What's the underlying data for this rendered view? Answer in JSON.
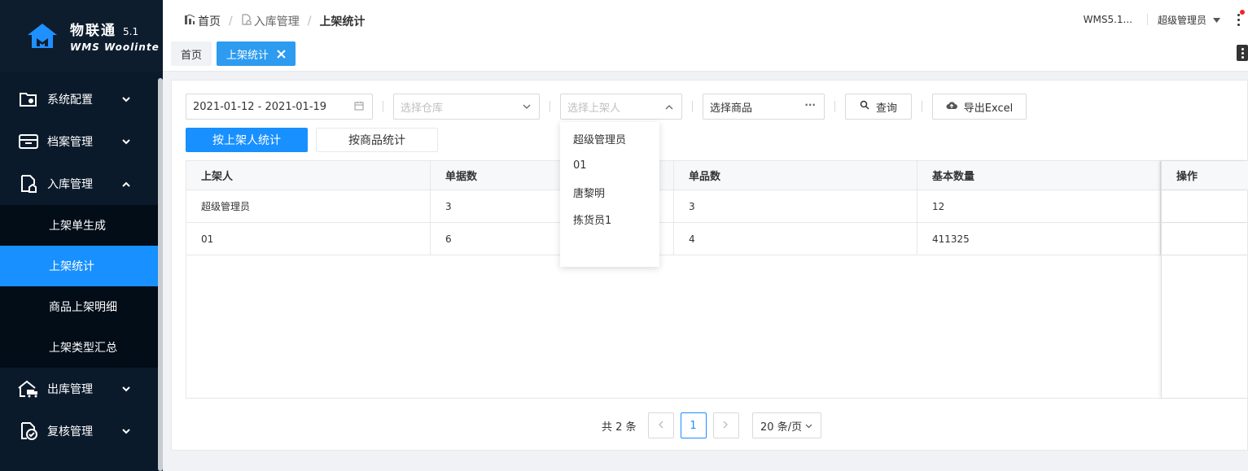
{
  "logo": {
    "title": "物联通",
    "version": "5.1",
    "subtitle": "WMS Woolinte"
  },
  "sidebar": {
    "items": [
      {
        "label": "系统配置",
        "icon": "gear-folder-icon",
        "expanded": false
      },
      {
        "label": "档案管理",
        "icon": "archive-icon",
        "expanded": false
      },
      {
        "label": "入库管理",
        "icon": "inbound-icon",
        "expanded": true
      },
      {
        "label": "出库管理",
        "icon": "outbound-truck-icon",
        "expanded": false
      },
      {
        "label": "复核管理",
        "icon": "check-doc-icon",
        "expanded": false
      }
    ],
    "subitems": [
      {
        "label": "上架单生成",
        "active": false
      },
      {
        "label": "上架统计",
        "active": true
      },
      {
        "label": "商品上架明细",
        "active": false
      },
      {
        "label": "上架类型汇总",
        "active": false
      }
    ]
  },
  "header": {
    "breadcrumb": [
      "首页",
      "入库管理",
      "上架统计"
    ],
    "version": "WMS5.1...",
    "user": "超级管理员"
  },
  "tabs": [
    {
      "label": "首页",
      "active": false
    },
    {
      "label": "上架统计",
      "active": true
    }
  ],
  "filters": {
    "date_range": "2021-01-12 - 2021-01-19",
    "warehouse_placeholder": "选择仓库",
    "shelver_placeholder": "选择上架人",
    "product_placeholder": "选择商品",
    "search_label": "查询",
    "export_label": "导出Excel"
  },
  "modes": {
    "by_shelver": "按上架人统计",
    "by_product": "按商品统计"
  },
  "table": {
    "columns": [
      "上架人",
      "单据数",
      "单品数",
      "基本数量",
      "操作"
    ],
    "rows": [
      [
        "超级管理员",
        "3",
        "3",
        "12",
        ""
      ],
      [
        "01",
        "6",
        "4",
        "411325",
        ""
      ]
    ]
  },
  "pagination": {
    "total": "共 2 条",
    "current": "1",
    "page_size": "20 条/页"
  },
  "dropdown": {
    "options": [
      "超级管理员",
      "01",
      "唐黎明",
      "拣货员1"
    ]
  },
  "colors": {
    "primary": "#1890ff",
    "sidebar_bg": "#0b1a2b",
    "active_tab": "#2d9bf0"
  }
}
